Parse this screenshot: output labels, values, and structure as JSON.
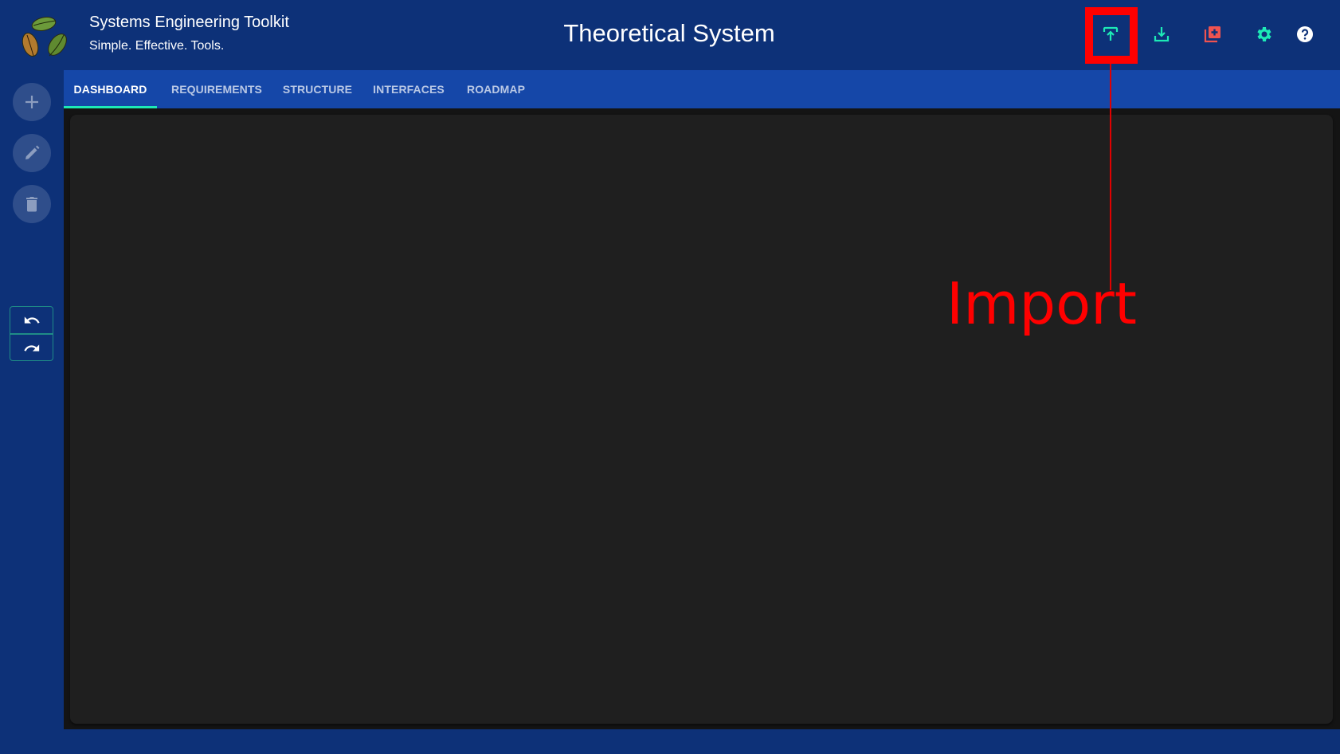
{
  "header": {
    "app_title": "Systems Engineering Toolkit",
    "app_subtitle": "Simple. Effective. Tools.",
    "document_title": "Theoretical System",
    "logo": "leaves-logo",
    "actions": [
      {
        "icon": "import-icon",
        "label": "Import",
        "color": "#1de9b6"
      },
      {
        "icon": "download-icon",
        "label": "Export",
        "color": "#1de9b6"
      },
      {
        "icon": "library-add-icon",
        "label": "New",
        "color": "#ef5350"
      },
      {
        "icon": "gear-icon",
        "label": "Settings",
        "color": "#1de9b6"
      },
      {
        "icon": "help-icon",
        "label": "Help",
        "color": "#ffffff"
      }
    ]
  },
  "sidebar": {
    "buttons": [
      {
        "icon": "plus-icon",
        "label": "Add"
      },
      {
        "icon": "pencil-icon",
        "label": "Edit"
      },
      {
        "icon": "trash-icon",
        "label": "Delete"
      }
    ],
    "history": [
      {
        "icon": "undo-icon",
        "label": "Undo"
      },
      {
        "icon": "redo-icon",
        "label": "Redo"
      }
    ]
  },
  "tabs": [
    {
      "label": "DASHBOARD",
      "active": true
    },
    {
      "label": "REQUIREMENTS",
      "active": false
    },
    {
      "label": "STRUCTURE",
      "active": false
    },
    {
      "label": "INTERFACES",
      "active": false
    },
    {
      "label": "ROADMAP",
      "active": false
    }
  ],
  "colors": {
    "header_bg": "#0d3178",
    "tabbar_bg": "#1547a8",
    "accent": "#1de9b6",
    "panel_bg": "#1f1f1f",
    "annotation": "#ff0000"
  },
  "annotation": {
    "label": "Import",
    "target": "import-button"
  }
}
